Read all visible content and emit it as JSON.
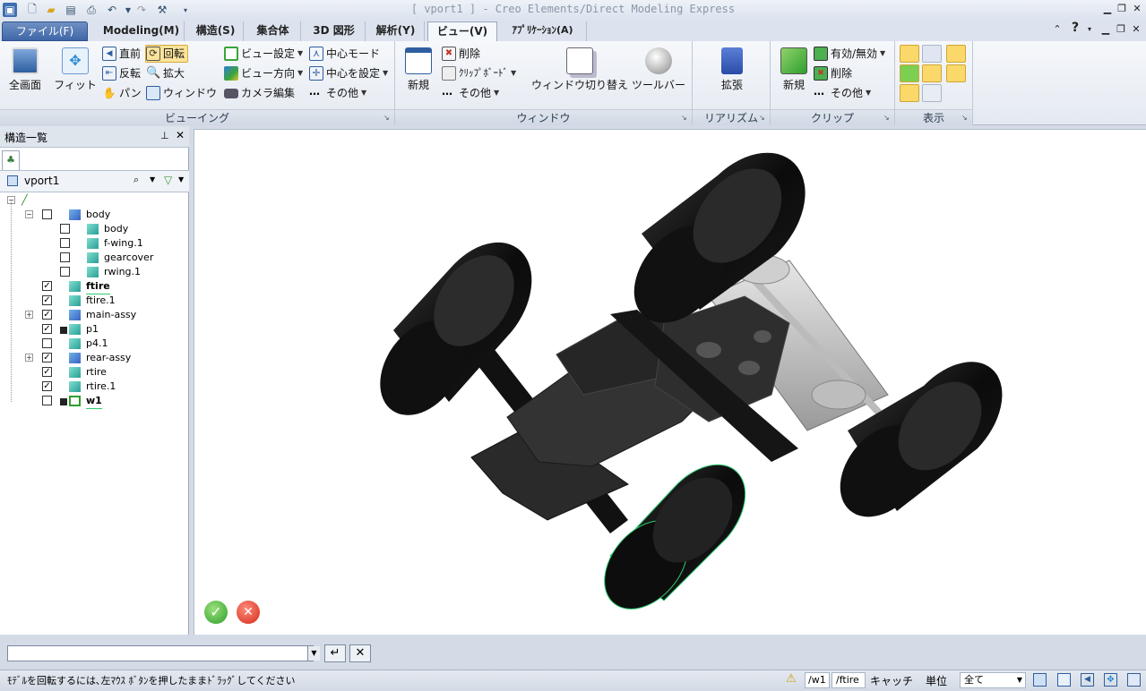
{
  "window": {
    "title": "[ vport1 ] - Creo Elements/Direct Modeling Express"
  },
  "tabs": [
    "ファイル(F)",
    "Modeling(M)",
    "構造(S)",
    "集合体",
    "3D 図形",
    "解析(Y)",
    "ビュー(V)",
    "ｱﾌﾟﾘｹｰｼｮﾝ(A)"
  ],
  "ribbon": {
    "viewing": {
      "label": "ビューイング",
      "fullscreen": "全画面",
      "fit": "フィット",
      "front": "直前",
      "rotate": "回転",
      "reverse": "反転",
      "zoom": "拡大",
      "pan": "パン",
      "window": "ウィンドウ",
      "view_settings": "ビュー設定",
      "view_direction": "ビュー方向",
      "camera_edit": "カメラ編集",
      "center_mode": "中心モード",
      "set_center": "中心を設定",
      "other": "その他"
    },
    "window": {
      "label": "ウィンドウ",
      "new": "新規",
      "delete": "削除",
      "clipboard": "ｸﾘｯﾌﾟﾎﾞｰﾄﾞ",
      "other": "その他",
      "switch": "ウィンドウ切り替え",
      "toolbar": "ツールバー"
    },
    "realism": {
      "label": "リアリズム",
      "extend": "拡張"
    },
    "clip": {
      "label": "クリップ",
      "new": "新規",
      "toggle": "有効/無効",
      "delete": "削除",
      "other": "その他"
    },
    "display": {
      "label": "表示"
    }
  },
  "panel": {
    "title": "構造一覧",
    "root": "vport1",
    "tree": [
      {
        "label": "body",
        "level": 1,
        "checked": false,
        "expander": "-",
        "icon": "assembly"
      },
      {
        "label": "body",
        "level": 2,
        "checked": false,
        "icon": "part"
      },
      {
        "label": "f-wing.1",
        "level": 2,
        "checked": false,
        "icon": "part"
      },
      {
        "label": "gearcover",
        "level": 2,
        "checked": false,
        "icon": "part"
      },
      {
        "label": "rwing.1",
        "level": 2,
        "checked": false,
        "icon": "part"
      },
      {
        "label": "ftire",
        "level": 1,
        "checked": true,
        "icon": "part",
        "bold": true
      },
      {
        "label": "ftire.1",
        "level": 1,
        "checked": true,
        "icon": "part"
      },
      {
        "label": "main-assy",
        "level": 1,
        "checked": true,
        "expander": "+",
        "icon": "assembly"
      },
      {
        "label": "p1",
        "level": 1,
        "checked": true,
        "icon": "part",
        "saved": true
      },
      {
        "label": "p4.1",
        "level": 1,
        "checked": false,
        "icon": "part"
      },
      {
        "label": "rear-assy",
        "level": 1,
        "checked": true,
        "expander": "+",
        "icon": "assembly"
      },
      {
        "label": "rtire",
        "level": 1,
        "checked": true,
        "icon": "part"
      },
      {
        "label": "rtire.1",
        "level": 1,
        "checked": true,
        "icon": "part"
      },
      {
        "label": "w1",
        "level": 1,
        "checked": false,
        "icon": "workplane",
        "bold": true,
        "saved": true
      }
    ]
  },
  "cmdline": {
    "value": ""
  },
  "status": {
    "message": "ﾓﾃﾞﾙを回転するには､左ﾏｳｽ ﾎﾞﾀﾝを押したままﾄﾞﾗｯｸﾞしてください",
    "wp": "/w1",
    "part": "/ftire",
    "catch": "キャッチ",
    "unit": "単位",
    "filter": "全て"
  },
  "colors": {
    "tire": "#0c0c0c",
    "chassis": "#2b2b2b",
    "axle": "#c8c8c8",
    "highlight": "#2ecc71",
    "accent": "#fbe39a"
  }
}
